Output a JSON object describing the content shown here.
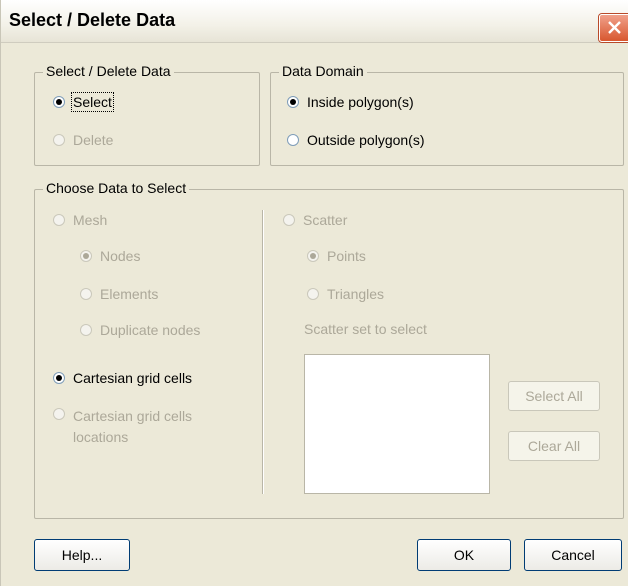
{
  "window": {
    "title": "Select / Delete Data"
  },
  "mode_group": {
    "legend": "Select / Delete Data",
    "select": "Select",
    "delete": "Delete"
  },
  "domain_group": {
    "legend": "Data Domain",
    "inside": "Inside polygon(s)",
    "outside": "Outside polygon(s)"
  },
  "choose_group": {
    "legend": "Choose Data to Select",
    "mesh": "Mesh",
    "nodes": "Nodes",
    "elements": "Elements",
    "duplicate_nodes": "Duplicate nodes",
    "cartesian_cells": "Cartesian grid cells",
    "cartesian_locations_line1": "Cartesian grid cells",
    "cartesian_locations_line2": "locations",
    "scatter": "Scatter",
    "points": "Points",
    "triangles": "Triangles",
    "scatter_set_label": "Scatter set to select",
    "select_all": "Select All",
    "clear_all": "Clear All"
  },
  "buttons": {
    "help": "Help...",
    "ok": "OK",
    "cancel": "Cancel"
  },
  "colors": {
    "disabled_text": "#aca899",
    "dialog_bg": "#ece9d8"
  }
}
